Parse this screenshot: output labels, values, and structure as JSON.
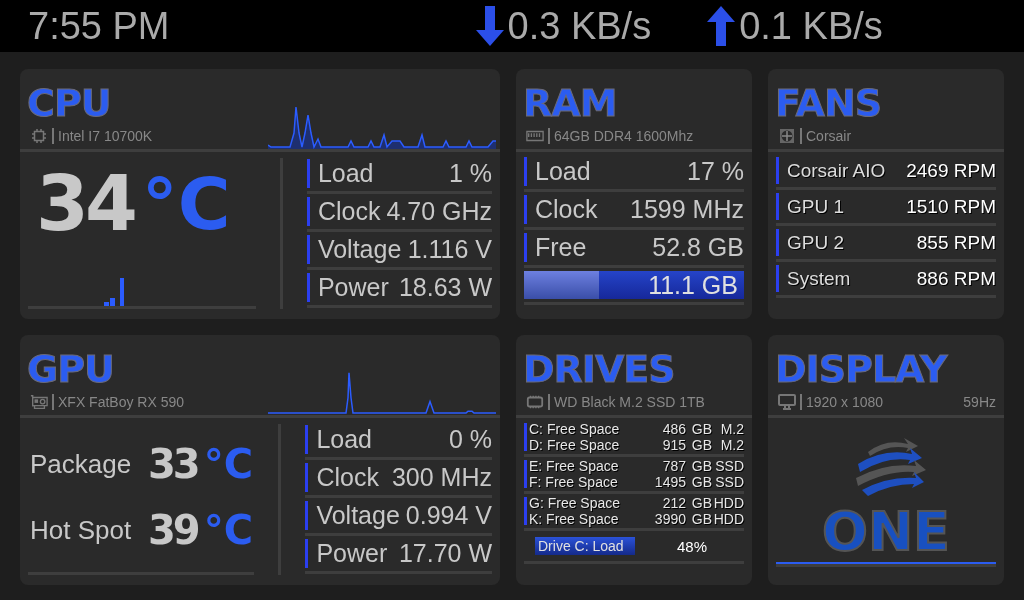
{
  "top_bar": {
    "time": "7:55 PM",
    "download": "0.3 KB/s",
    "upload": "0.1 KB/s"
  },
  "cpu": {
    "title": "CPU",
    "model": "Intel I7 10700K",
    "temperature": "34",
    "unit": "°C",
    "stats": [
      {
        "label": "Load",
        "value": "1 %"
      },
      {
        "label": "Clock",
        "value": "4.70 GHz"
      },
      {
        "label": "Voltage",
        "value": "1.116 V"
      },
      {
        "label": "Power",
        "value": "18.63 W"
      }
    ]
  },
  "ram": {
    "title": "RAM",
    "model": "64GB DDR4 1600Mhz",
    "stats": [
      {
        "label": "Load",
        "value": "17 %"
      },
      {
        "label": "Clock",
        "value": "1599 MHz"
      },
      {
        "label": "Free",
        "value": "52.8 GB"
      }
    ],
    "used": {
      "value": "11.1 GB",
      "level": 0.34
    }
  },
  "fans": {
    "title": "FANS",
    "brand": "Corsair",
    "rows": [
      {
        "label": "Corsair AIO",
        "value": "2469 RPM"
      },
      {
        "label": "GPU 1",
        "value": "1510 RPM"
      },
      {
        "label": "GPU 2",
        "value": "855 RPM"
      },
      {
        "label": "System",
        "value": "886 RPM"
      }
    ]
  },
  "gpu": {
    "title": "GPU",
    "model": "XFX FatBoy RX 590",
    "temps": [
      {
        "label": "Package",
        "value": "33",
        "unit": "°C"
      },
      {
        "label": "Hot Spot",
        "value": "39",
        "unit": "°C"
      }
    ],
    "stats": [
      {
        "label": "Load",
        "value": "0 %"
      },
      {
        "label": "Clock",
        "value": "300 MHz"
      },
      {
        "label": "Voltage",
        "value": "0.994 V"
      },
      {
        "label": "Power",
        "value": "17.70 W"
      }
    ]
  },
  "drives": {
    "title": "DRIVES",
    "model": "WD Black M.2 SSD 1TB",
    "groups": [
      [
        {
          "label": "C: Free Space",
          "value": "486",
          "unit": "GB",
          "type": "M.2"
        },
        {
          "label": "D: Free Space",
          "value": "915",
          "unit": "GB",
          "type": "M.2"
        }
      ],
      [
        {
          "label": "E: Free Space",
          "value": "787",
          "unit": "GB",
          "type": "SSD"
        },
        {
          "label": "F: Free Space",
          "value": "1495",
          "unit": "GB",
          "type": "SSD"
        }
      ],
      [
        {
          "label": "G: Free Space",
          "value": "212",
          "unit": "GB",
          "type": "HDD"
        },
        {
          "label": "K: Free Space",
          "value": "3990",
          "unit": "GB",
          "type": "HDD"
        }
      ]
    ],
    "load": {
      "label": "Drive C: Load",
      "value": "48%"
    }
  },
  "display": {
    "title": "DISPLAY",
    "resolution": "1920 x 1080",
    "refresh": "59Hz",
    "logo_text": "ONE"
  }
}
